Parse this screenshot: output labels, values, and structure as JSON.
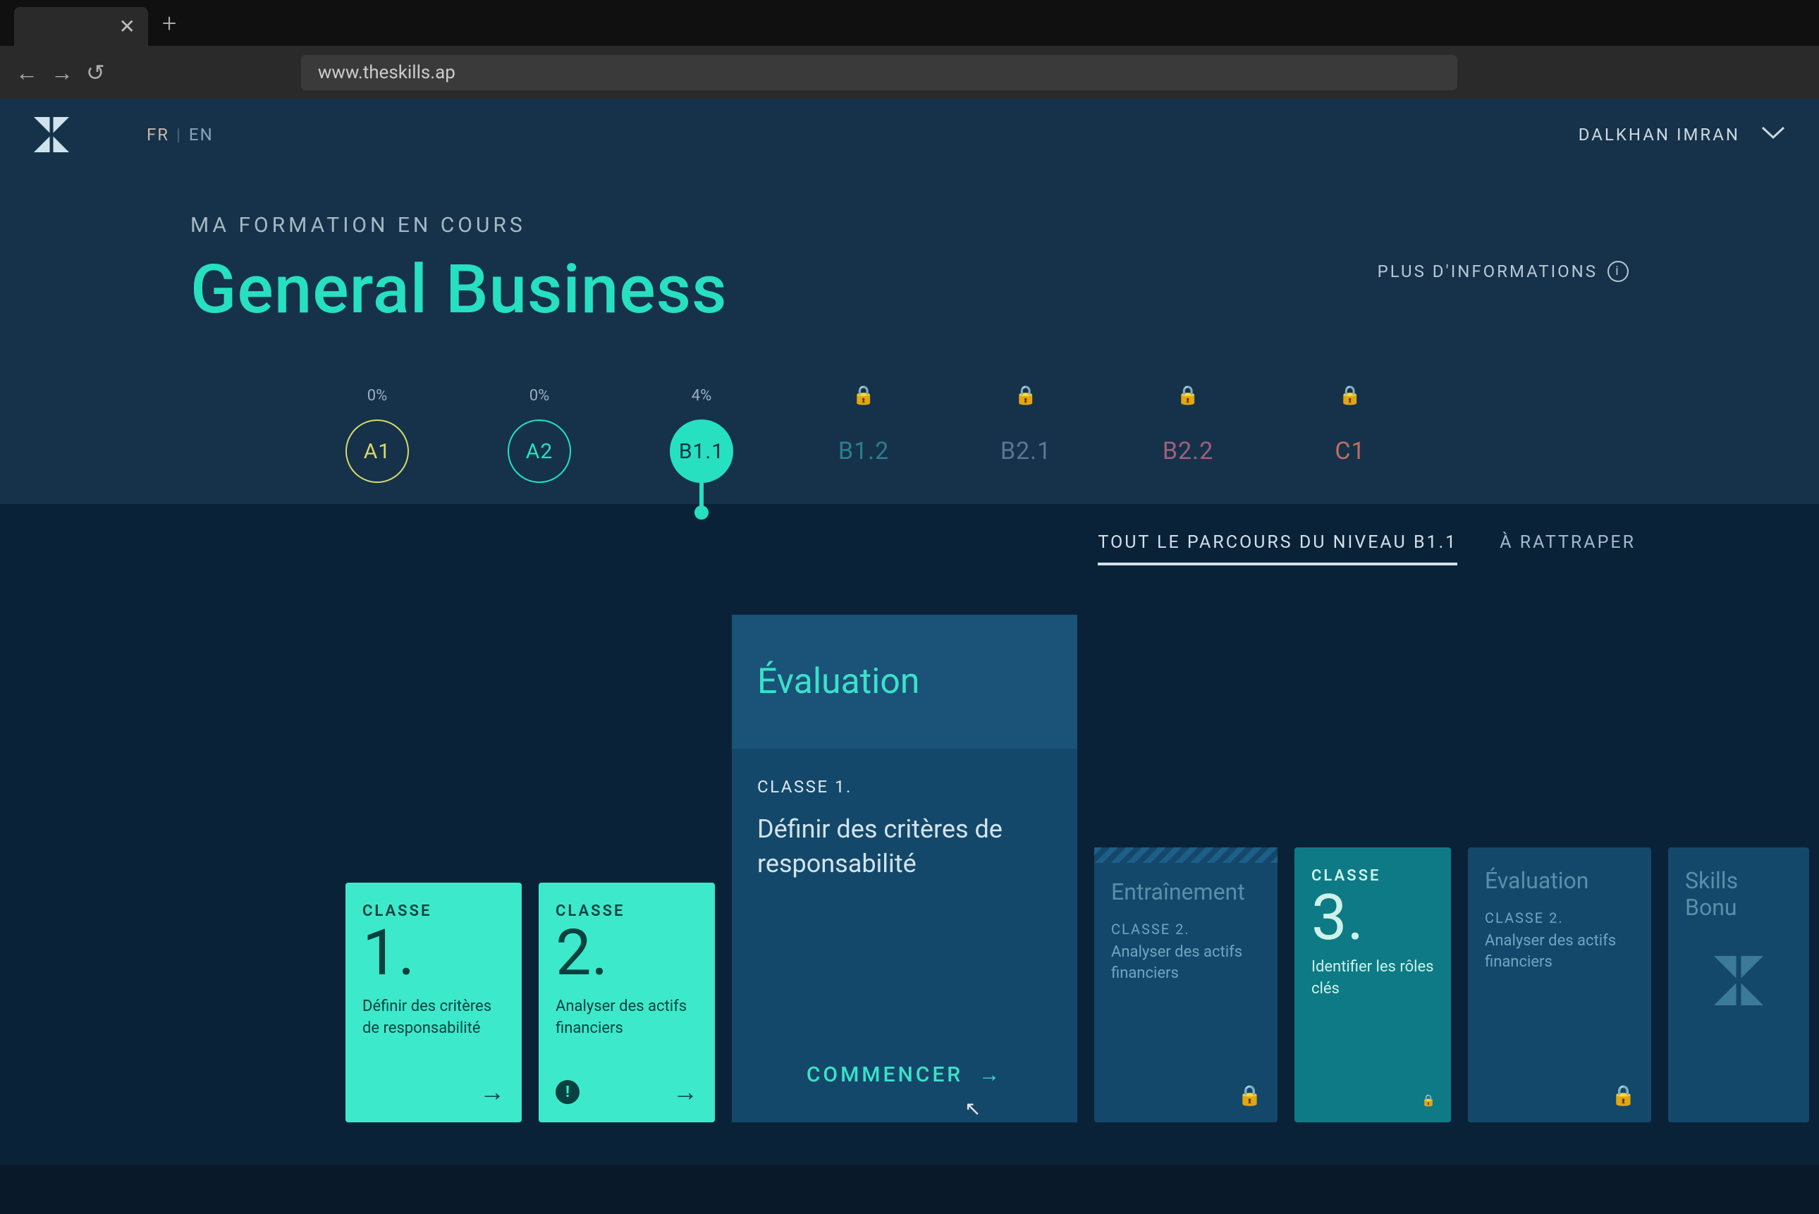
{
  "browser": {
    "url": "www.theskills.ap"
  },
  "header": {
    "lang_active": "FR",
    "lang_other": "EN",
    "user": "DALKHAN IMRAN"
  },
  "hero": {
    "eyebrow": "MA FORMATION EN COURS",
    "title": "General Business",
    "more_info": "PLUS D'INFORMATIONS"
  },
  "levels": [
    {
      "id": "A1",
      "pct": "0%",
      "locked": false
    },
    {
      "id": "A2",
      "pct": "0%",
      "locked": false
    },
    {
      "id": "B1.1",
      "pct": "4%",
      "locked": false,
      "active": true
    },
    {
      "id": "B1.2",
      "locked": true
    },
    {
      "id": "B2.1",
      "locked": true
    },
    {
      "id": "B2.2",
      "locked": true
    },
    {
      "id": "C1",
      "locked": true
    }
  ],
  "filter_tabs": {
    "all": "TOUT LE PARCOURS DU NIVEAU B1.1",
    "todo": "À RATTRAPER"
  },
  "cards": {
    "classe1": {
      "eyebrow": "CLASSE",
      "num": "1.",
      "desc": "Définir des critères de responsabilité"
    },
    "classe2": {
      "eyebrow": "CLASSE",
      "num": "2.",
      "desc": "Analyser des actifs financiers"
    },
    "evaluation_big": {
      "title": "Évaluation",
      "eyebrow": "CLASSE 1.",
      "desc": "Définir des critères de responsabilité",
      "cta": "COMMENCER"
    },
    "entrainement": {
      "title": "Entraînement",
      "eyebrow": "CLASSE 2.",
      "desc": "Analyser des actifs financiers"
    },
    "classe3": {
      "eyebrow": "CLASSE",
      "num": "3.",
      "desc": "Identifier les rôles clés"
    },
    "evaluation_small": {
      "title": "Évaluation",
      "eyebrow": "CLASSE 2.",
      "desc": "Analyser des actifs financiers"
    },
    "skillsbonus": {
      "title": "Skills Bonu"
    }
  }
}
